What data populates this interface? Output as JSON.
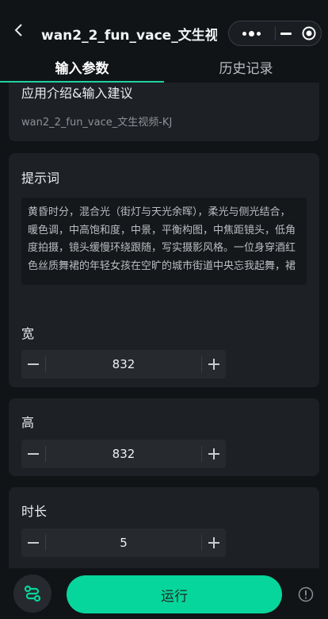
{
  "header": {
    "title": "wan2_2_fun_vace_文生视...",
    "back_icon": "back-chevron-icon",
    "more_icon": "more-dots-icon",
    "minimize_icon": "minimize-icon",
    "close_icon": "target-close-icon"
  },
  "tabs": [
    {
      "label": "输入参数",
      "active": true
    },
    {
      "label": "历史记录",
      "active": false
    }
  ],
  "intro": {
    "label": "应用介绍&输入建议",
    "subtitle": "wan2_2_fun_vace_文生视频-KJ"
  },
  "prompt": {
    "label": "提示词",
    "value": "黄昏时分，混合光（街灯与天光余晖），柔光与侧光结合，暖色调，中高饱和度，中景，平衡构图，中焦距镜头，低角度拍摄，镜头缓慢环绕跟随，写实摄影风格。一位身穿酒红色丝质舞裙的年轻女孩在空旷的城市街道中央忘我起舞，裙"
  },
  "width": {
    "label": "宽",
    "value": "832"
  },
  "height": {
    "label": "高",
    "value": "832"
  },
  "duration": {
    "label": "时长",
    "value": "5"
  },
  "bottom": {
    "run_label": "运行",
    "flow_icon": "workflow-icon",
    "info_icon": "info-icon"
  },
  "colors": {
    "accent": "#07d69c",
    "background": "#111417",
    "card": "#1d2024"
  }
}
